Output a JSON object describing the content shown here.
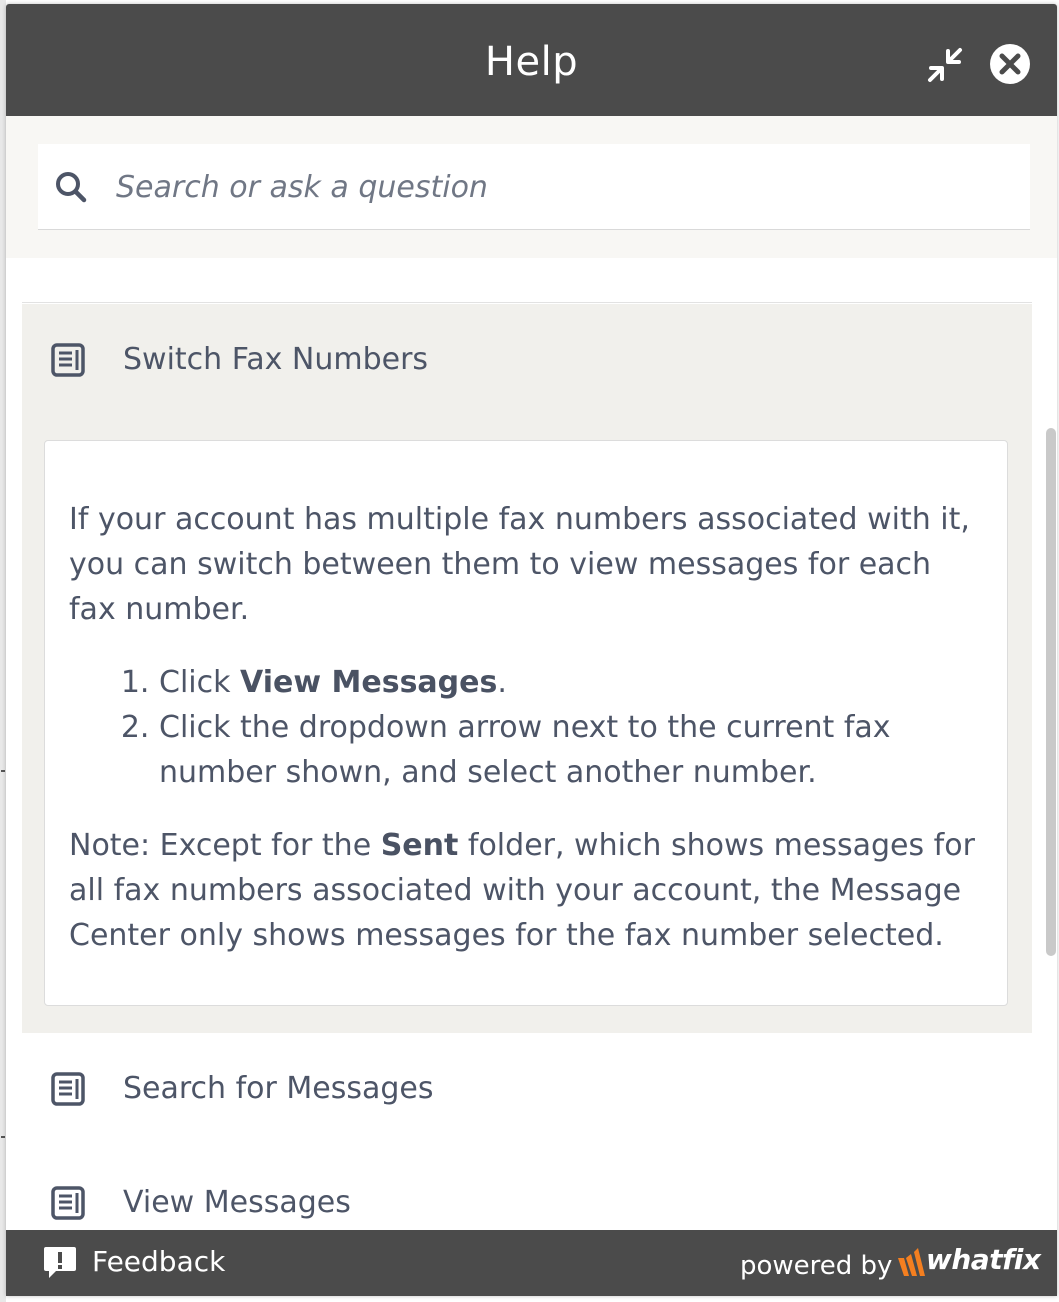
{
  "header": {
    "title": "Help",
    "collapse_icon": "collapse-arrows-icon",
    "close_icon": "close-circle-icon"
  },
  "search": {
    "placeholder": "Search or ask a question",
    "value": ""
  },
  "articles": {
    "expanded": {
      "title": "Switch Fax Numbers",
      "intro": "If your account has multiple fax numbers associated with it, you can switch between them to view messages for each fax number.",
      "steps": [
        {
          "prefix": "Click ",
          "bold": "View Messages",
          "suffix": "."
        },
        {
          "prefix": "Click the dropdown arrow next to the current fax number shown, and select another number.",
          "bold": "",
          "suffix": ""
        }
      ],
      "note_prefix": "Note: Except for the ",
      "note_bold": "Sent",
      "note_suffix": " folder, which shows messages for all fax numbers associated with your account, the Message Center only shows messages for the fax number selected."
    },
    "items": [
      {
        "title": "Search for Messages"
      },
      {
        "title": "View Messages"
      }
    ]
  },
  "footer": {
    "feedback_label": "Feedback",
    "powered_by": "powered by",
    "brand": "whatfix"
  },
  "colors": {
    "header_bg": "#4b4b4b",
    "text": "#4d5567",
    "expanded_bg": "#f1f0ec",
    "brand_orange": "#f47f20"
  }
}
